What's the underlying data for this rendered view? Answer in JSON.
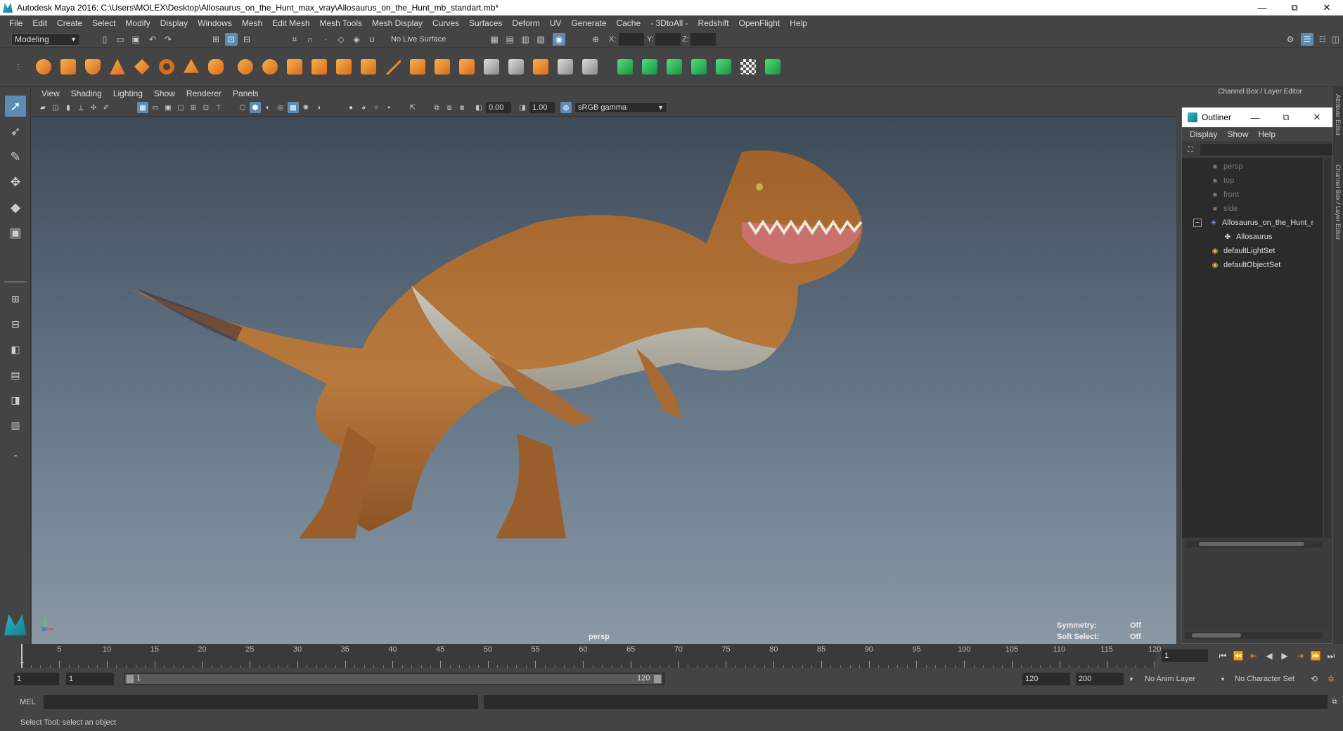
{
  "title": "Autodesk Maya 2016: C:\\Users\\MOLEX\\Desktop\\Allosaurus_on_the_Hunt_max_vray\\Allosaurus_on_the_Hunt_mb_standart.mb*",
  "window_controls": {
    "minimize": "—",
    "restore": "⧉",
    "close": "✕"
  },
  "menubar": [
    "File",
    "Edit",
    "Create",
    "Select",
    "Modify",
    "Display",
    "Windows",
    "Mesh",
    "Edit Mesh",
    "Mesh Tools",
    "Mesh Display",
    "Curves",
    "Surfaces",
    "Deform",
    "UV",
    "Generate",
    "Cache",
    "- 3DtoAll -",
    "Redshift",
    "OpenFlight",
    "Help"
  ],
  "status_line": {
    "mode": "Modeling",
    "live_surface": "No Live Surface",
    "x_label": "X:",
    "y_label": "Y:",
    "z_label": "Z:"
  },
  "viewport": {
    "menu": [
      "View",
      "Shading",
      "Lighting",
      "Show",
      "Renderer",
      "Panels"
    ],
    "exposure": "0.00",
    "gamma": "1.00",
    "color_space": "sRGB gamma",
    "camera_label": "persp",
    "symmetry_label": "Symmetry:",
    "symmetry_value": "Off",
    "soft_select_label": "Soft Select:",
    "soft_select_value": "Off"
  },
  "right_panel": {
    "header": "Channel Box / Layer Editor",
    "side_tabs": [
      "Attribute Editor",
      "Channel Box / Layer Editor"
    ],
    "outliner": {
      "title": "Outliner",
      "menu": [
        "Display",
        "Show",
        "Help"
      ],
      "items": [
        {
          "label": "persp",
          "icon": "camera-icon",
          "dim": true
        },
        {
          "label": "top",
          "icon": "camera-icon",
          "dim": true
        },
        {
          "label": "front",
          "icon": "camera-icon",
          "dim": true
        },
        {
          "label": "side",
          "icon": "camera-icon",
          "dim": true
        },
        {
          "label": "Allosaurus_on_the_Hunt_r",
          "icon": "group-icon",
          "dim": false,
          "expander": "−"
        },
        {
          "label": "Allosaurus",
          "icon": "joint-icon",
          "dim": false
        },
        {
          "label": "defaultLightSet",
          "icon": "set-icon",
          "dim": false
        },
        {
          "label": "defaultObjectSet",
          "icon": "set-icon",
          "dim": false
        }
      ]
    }
  },
  "timeline": {
    "ticks": [
      1,
      5,
      10,
      15,
      20,
      25,
      30,
      35,
      40,
      45,
      50,
      55,
      60,
      65,
      70,
      75,
      80,
      85,
      90,
      95,
      100,
      105,
      110,
      115,
      120
    ],
    "current_frame": "1"
  },
  "range_slider": {
    "start": "1",
    "anim_start": "1",
    "range_start": "1",
    "range_end": "120",
    "end": "120",
    "anim_end": "200",
    "anim_layer": "No Anim Layer",
    "character_set": "No Character Set"
  },
  "command_line": {
    "language": "MEL"
  },
  "help_line": "Select Tool: select an object",
  "colors": {
    "accent": "#5c8bb3",
    "maya_teal": "#2fb8c8",
    "shelf_orange": "#e8872c",
    "shelf_green": "#3cc768"
  }
}
